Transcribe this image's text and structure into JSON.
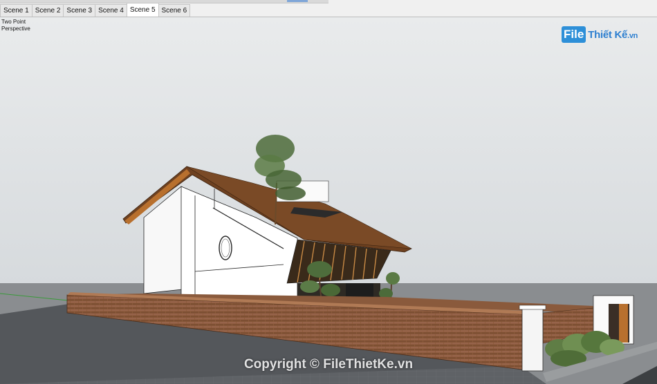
{
  "tabs": [
    {
      "label": "Scene 1",
      "active": false
    },
    {
      "label": "Scene 2",
      "active": false
    },
    {
      "label": "Scene 3",
      "active": false
    },
    {
      "label": "Scene 4",
      "active": false
    },
    {
      "label": "Scene 5",
      "active": true
    },
    {
      "label": "Scene 6",
      "active": false
    }
  ],
  "viewport": {
    "camera_line1": "Two Point",
    "camera_line2": "Perspective"
  },
  "logo": {
    "file": "File",
    "rest": "Thiết Kế",
    "tld": ".vn"
  },
  "watermark": "Copyright © FileThietKe.vn",
  "colors": {
    "sky": "#dfe3e6",
    "ground": "#5c5f63",
    "roof": "#6b3f1f",
    "brick": "#8a5a3c",
    "wall": "#ffffff",
    "logo_blue": "#2d8fd8"
  }
}
